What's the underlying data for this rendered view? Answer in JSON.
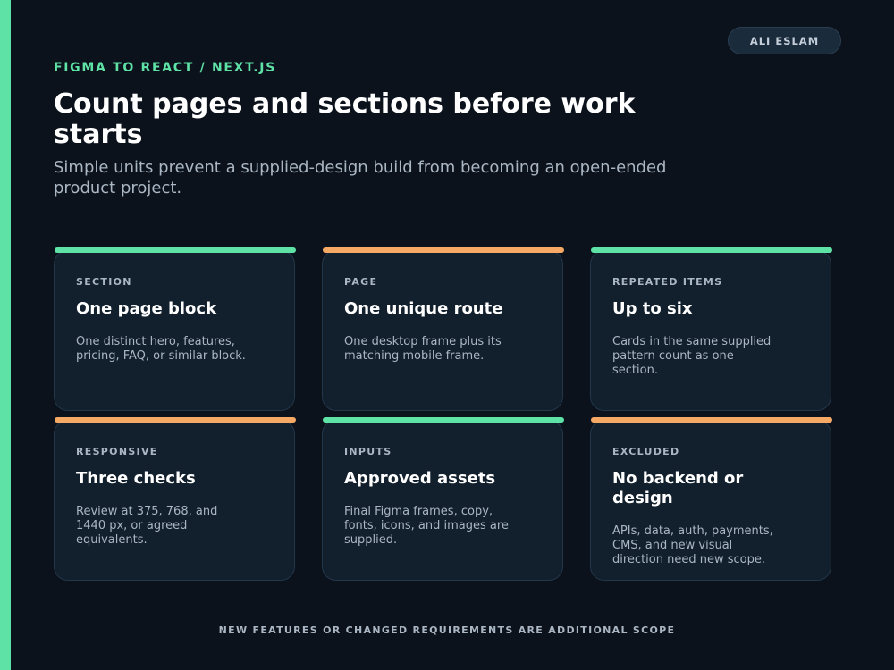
{
  "header": {
    "author": "ALI ESLAM",
    "eyebrow": "FIGMA TO REACT / NEXT.JS",
    "title": "Count pages and sections before work starts",
    "subtitle": "Simple units prevent a supplied-design build from becoming an open-ended product project."
  },
  "colors": {
    "background": "#0b121c",
    "accent_green": "#5ee2a6",
    "accent_orange": "#f5a965",
    "card_bg": "#121f2c"
  },
  "cards": [
    {
      "kicker": "SECTION",
      "title": "One page block",
      "body": "One distinct hero, features, pricing, FAQ, or similar block.",
      "accent": "green"
    },
    {
      "kicker": "PAGE",
      "title": "One unique route",
      "body": "One desktop frame plus its matching mobile frame.",
      "accent": "orange"
    },
    {
      "kicker": "REPEATED ITEMS",
      "title": "Up to six",
      "body": "Cards in the same supplied pattern count as one section.",
      "accent": "green"
    },
    {
      "kicker": "RESPONSIVE",
      "title": "Three checks",
      "body": "Review at 375, 768, and 1440 px, or agreed equivalents.",
      "accent": "orange"
    },
    {
      "kicker": "INPUTS",
      "title": "Approved assets",
      "body": "Final Figma frames, copy, fonts, icons, and images are supplied.",
      "accent": "green"
    },
    {
      "kicker": "EXCLUDED",
      "title": "No backend or design",
      "body": "APIs, data, auth, payments, CMS, and new visual direction need new scope.",
      "accent": "orange"
    }
  ],
  "footer": "NEW FEATURES OR CHANGED REQUIREMENTS ARE ADDITIONAL SCOPE"
}
